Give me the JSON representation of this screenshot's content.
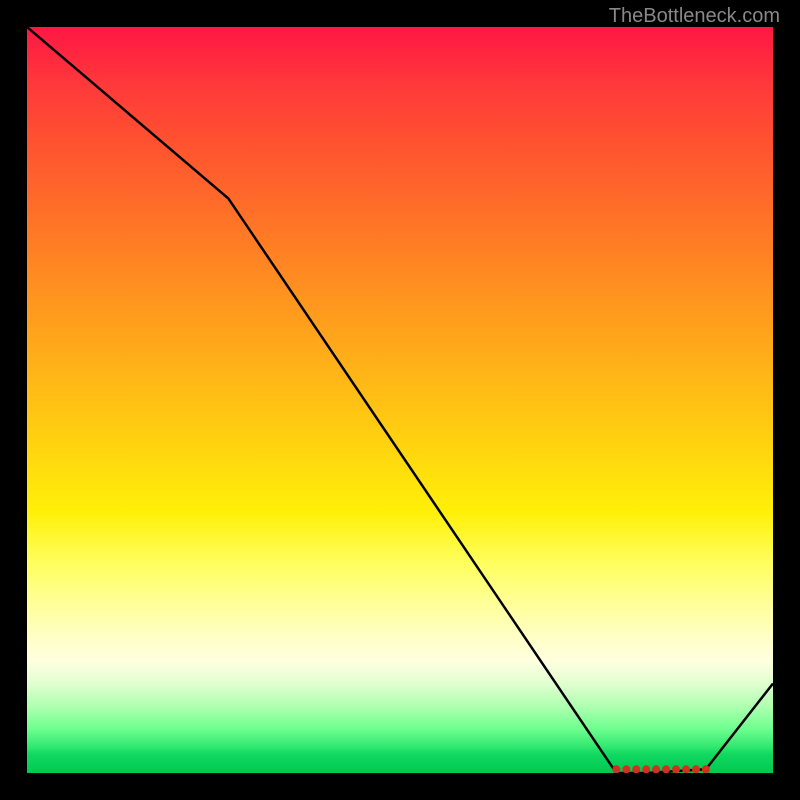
{
  "watermark": "TheBottleneck.com",
  "chart_data": {
    "type": "line",
    "title": "",
    "xlabel": "",
    "ylabel": "",
    "x": [
      0,
      27,
      79,
      83,
      91,
      100
    ],
    "values": [
      100,
      77,
      0,
      0,
      0.5,
      12
    ],
    "ylim": [
      0,
      100
    ],
    "xlim": [
      0,
      100
    ],
    "markers": {
      "x_range": [
        79,
        91
      ],
      "y": 0.5,
      "count": 10
    }
  }
}
